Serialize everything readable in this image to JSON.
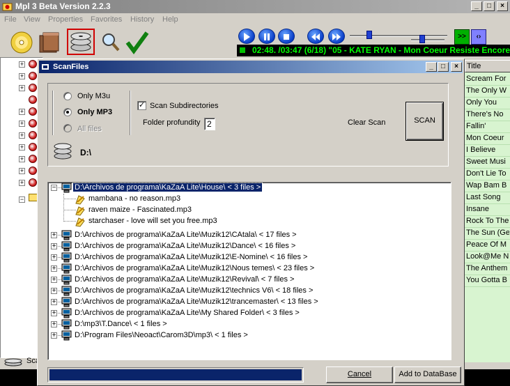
{
  "app": {
    "title": "Mpl 3 Beta Version 2.2.3",
    "menu": [
      "File",
      "View",
      "Properties",
      "Favorites",
      "History",
      "Help"
    ],
    "toolbar_icons": [
      "cd-icon",
      "books-icon",
      "scan-disks-icon",
      "search-icon",
      "check-icon"
    ]
  },
  "player": {
    "now_playing": "02:48.  /03:47 (6/18)  \"05 - KATE RYAN - Mon Coeur Resiste Encore",
    "btn_next_label": ">>",
    "btn_toggle_label": "‹›"
  },
  "playlist": {
    "header": "Title",
    "items": [
      "Scream For",
      "The Only W",
      "Only You",
      "There's No",
      "Fallin'",
      "Mon Coeur",
      "I Believe",
      "Sweet Musi",
      "Don't Lie To",
      "Wap Bam B",
      "Last Song",
      "Insane",
      "Rock To The",
      "The Sun (Ge",
      "Peace Of M",
      "Look@Me N",
      "The Anthem",
      "You Gotta B"
    ]
  },
  "status_left": "Sca",
  "dialog": {
    "title": "ScanFiles",
    "options": {
      "only_m3u": "Only M3u",
      "only_mp3": "Only MP3",
      "all_files": "All files",
      "scan_subdirs": "Scan Subdirectories",
      "folder_profundity_label": "Folder profundity",
      "folder_profundity_value": "2",
      "drive": "D:\\",
      "clear_scan": "Clear Scan",
      "scan_button": "SCAN"
    },
    "tree": {
      "expanded": {
        "path": "D:\\Archivos de programa\\KaZaA Lite\\House\\   < 3 files >",
        "files": [
          "mambana - no reason.mp3",
          "raven maize - Fascinated.mp3",
          "starchaser - love will set you free.mp3"
        ]
      },
      "folders": [
        "D:\\Archivos de programa\\KaZaA Lite\\Muzik12\\CAtala\\   < 17 files >",
        "D:\\Archivos de programa\\KaZaA Lite\\Muzik12\\Dance\\   < 16 files >",
        "D:\\Archivos de programa\\KaZaA Lite\\Muzik12\\E-Nomine\\   < 16 files >",
        "D:\\Archivos de programa\\KaZaA Lite\\Muzik12\\Nous temes\\   < 23 files >",
        "D:\\Archivos de programa\\KaZaA Lite\\Muzik12\\Revival\\   < 7 files >",
        "D:\\Archivos de programa\\KaZaA Lite\\Muzik12\\technics V6\\   < 18 files >",
        "D:\\Archivos de programa\\KaZaA Lite\\Muzik12\\trancemaster\\   < 13 files >",
        "D:\\Archivos de programa\\KaZaA Lite\\My Shared Folder\\   < 3 files >",
        "D:\\mp3\\T.Dance\\   < 1 files >",
        "D:\\Program Files\\Neoact\\Carom3D\\mp3\\   < 1 files >"
      ]
    },
    "progress": 1.0,
    "cancel": "Cancel",
    "add_to_database": "Add to DataBase"
  }
}
